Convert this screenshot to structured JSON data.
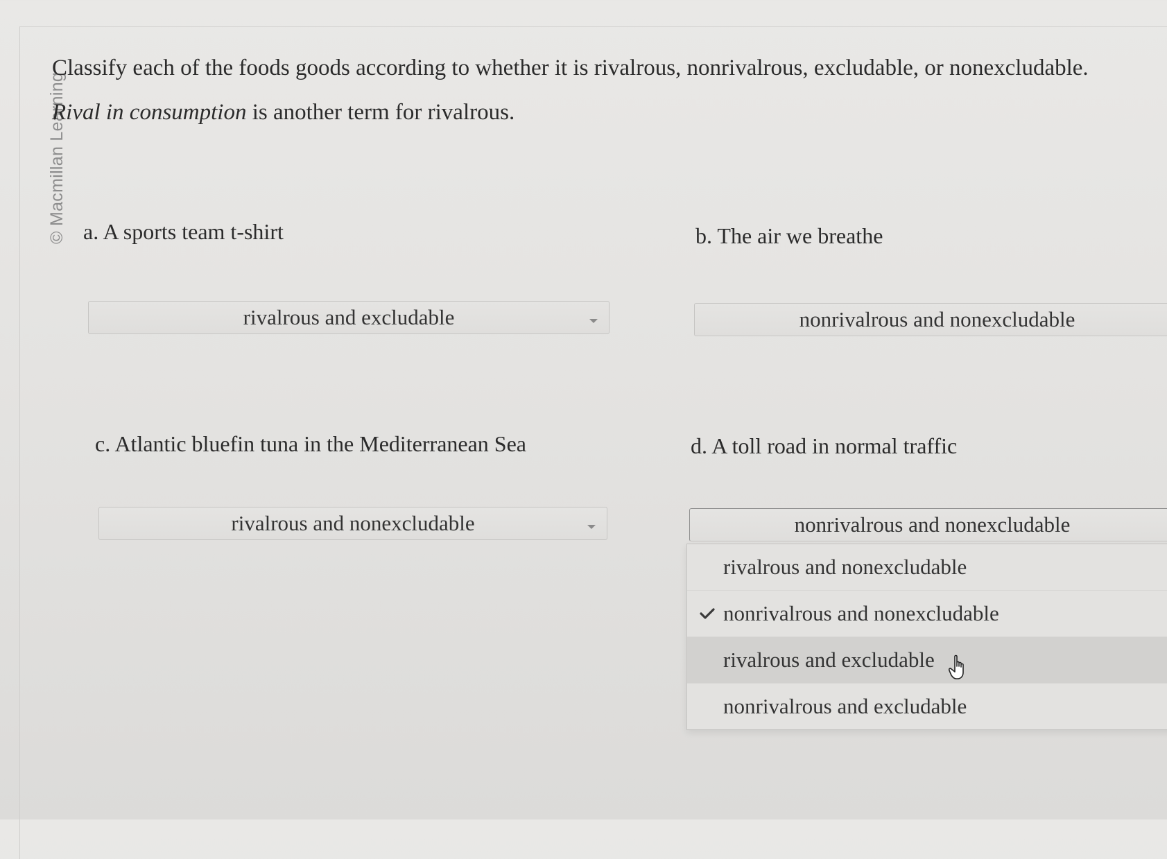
{
  "watermark": "© Macmillan Learning",
  "instructions": {
    "line1": "Classify each of the foods goods according to whether it is rivalrous, nonrivalrous, excludable, or nonexcludable.",
    "line2_italic": "Rival in consumption",
    "line2_rest": " is another term for rivalrous."
  },
  "questions": {
    "a": {
      "letter": "a.",
      "text": " A sports team t-shirt",
      "selected": "rivalrous and excludable"
    },
    "b": {
      "letter": "b.",
      "text": " The air we breathe",
      "selected": "nonrivalrous and nonexcludable"
    },
    "c": {
      "letter": "c.",
      "text": " Atlantic bluefin tuna in the Mediterranean Sea",
      "selected": "rivalrous and nonexcludable"
    },
    "d": {
      "letter": "d.",
      "text": " A toll road in normal traffic",
      "selected": "nonrivalrous and nonexcludable"
    }
  },
  "dropdown_options": [
    {
      "label": "rivalrous and nonexcludable",
      "checked": false,
      "highlighted": false
    },
    {
      "label": "nonrivalrous and nonexcludable",
      "checked": true,
      "highlighted": false
    },
    {
      "label": "rivalrous and excludable",
      "checked": false,
      "highlighted": true
    },
    {
      "label": "nonrivalrous and excludable",
      "checked": false,
      "highlighted": false
    }
  ],
  "icons": {
    "check": "checkmark-icon",
    "cursor": "hand-pointer-icon",
    "caret": "caret-down-icon"
  }
}
